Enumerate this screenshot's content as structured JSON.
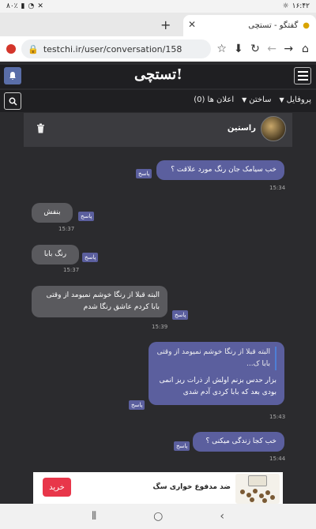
{
  "status_bar": {
    "time": "۱۶:۴۲",
    "left_icons": "۸۰٪"
  },
  "browser": {
    "tab_title": "گفتگو - تستچی",
    "url": "testchi.ir/user/conversation/158"
  },
  "site": {
    "logo": "تستچی!",
    "nav": [
      {
        "label": "پروفایل"
      },
      {
        "label": "ساختن"
      },
      {
        "label": "اعلان ها (0)"
      }
    ]
  },
  "chat": {
    "name": "راستین",
    "reply_label": "پاسخ",
    "messages": [
      {
        "text": "خب سیامک جان رنگ مورد علاقت ؟",
        "time": "15:34"
      },
      {
        "text": "بنفش",
        "time": "15:37"
      },
      {
        "text": "رنگ بابا",
        "time": "15:37"
      },
      {
        "text": "البته قبلا از رنگا خوشم نمیومد از وقتی بابا کردم عاشق رنگا شدم",
        "time": "15:39"
      },
      {
        "quote": "البته قبلا از رنگا خوشم نمیومد از وقتی بابا ک...",
        "text": "بزار حدس بزنم اولش از ذرات ریز انمی بودی بعد که بابا کردی آدم شدی",
        "time": "15:43"
      },
      {
        "text": "خب کجا زندگی میکنی ؟",
        "time": "15:44"
      }
    ]
  },
  "ad": {
    "text": "ضد مدفوع خواری سگ",
    "button": "خرید"
  },
  "colors": {
    "bubble_mine": "#5b5f9e",
    "bubble_theirs": "#5a5a5e",
    "ad_button": "#e8364a"
  }
}
